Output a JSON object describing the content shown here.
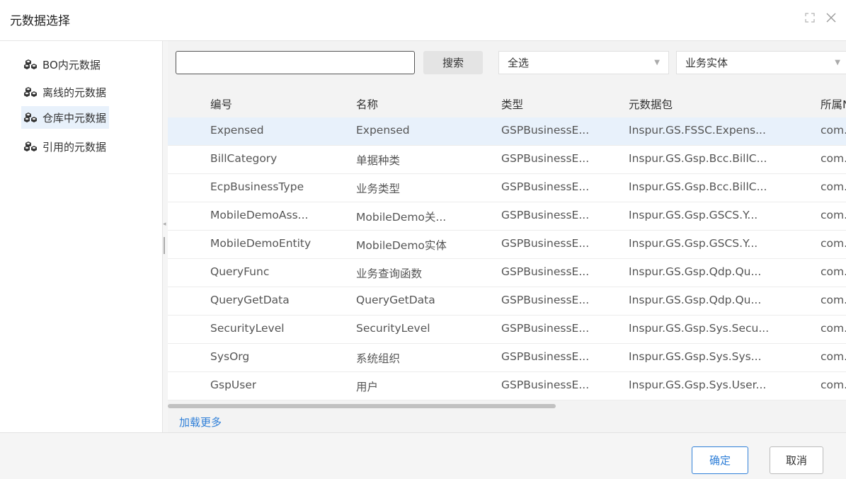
{
  "dialog": {
    "title": "元数据选择"
  },
  "left_nav": {
    "items": [
      {
        "label": "BO内元数据",
        "active": false
      },
      {
        "label": "离线的元数据",
        "active": false
      },
      {
        "label": "仓库中元数据",
        "active": true
      },
      {
        "label": "引用的元数据",
        "active": false
      }
    ]
  },
  "toolbar": {
    "search_value": "",
    "search_button": "搜索",
    "filter_all": "全选",
    "filter_type": "业务实体"
  },
  "table": {
    "columns": [
      "编号",
      "名称",
      "类型",
      "元数据包",
      "所属N"
    ],
    "rows": [
      [
        "Expensed",
        "Expensed",
        "GSPBusinessE...",
        "Inspur.GS.FSSC.Expens...",
        "com."
      ],
      [
        "BillCategory",
        "单据种类",
        "GSPBusinessE...",
        "Inspur.GS.Gsp.Bcc.BillC...",
        "com."
      ],
      [
        "EcpBusinessType",
        "业务类型",
        "GSPBusinessE...",
        "Inspur.GS.Gsp.Bcc.BillC...",
        "com."
      ],
      [
        "MobileDemoAss...",
        "MobileDemo关...",
        "GSPBusinessE...",
        "Inspur.GS.Gsp.GSCS.Y...",
        "com."
      ],
      [
        "MobileDemoEntity",
        "MobileDemo实体",
        "GSPBusinessE...",
        "Inspur.GS.Gsp.GSCS.Y...",
        "com."
      ],
      [
        "QueryFunc",
        "业务查询函数",
        "GSPBusinessE...",
        "Inspur.GS.Gsp.Qdp.Qu...",
        "com."
      ],
      [
        "QueryGetData",
        "QueryGetData",
        "GSPBusinessE...",
        "Inspur.GS.Gsp.Qdp.Qu...",
        "com."
      ],
      [
        "SecurityLevel",
        "SecurityLevel",
        "GSPBusinessE...",
        "Inspur.GS.Gsp.Sys.Secu...",
        "com."
      ],
      [
        "SysOrg",
        "系统组织",
        "GSPBusinessE...",
        "Inspur.GS.Gsp.Sys.Sys...",
        "com."
      ],
      [
        "GspUser",
        "用户",
        "GSPBusinessE...",
        "Inspur.GS.Gsp.Sys.User...",
        "com."
      ]
    ],
    "selected_row": 0,
    "load_more": "加载更多"
  },
  "footer": {
    "ok": "确定",
    "cancel": "取消"
  },
  "colors": {
    "accent": "#2f7fd8",
    "selected_row": "#e8f1fb",
    "panel_bg": "#f3f3f3"
  },
  "icons": {
    "left_item": "cubes-icon",
    "fullscreen": "fullscreen-icon",
    "close": "close-icon"
  }
}
